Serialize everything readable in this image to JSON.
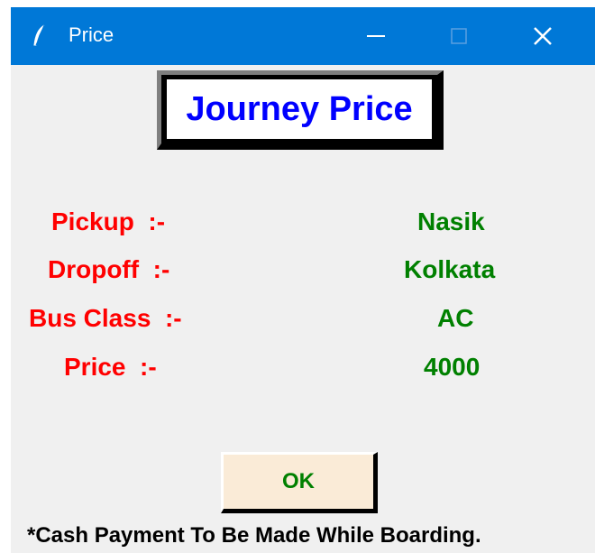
{
  "window": {
    "title": "Price",
    "icon": "feather-icon",
    "controls": [
      "minimize-icon",
      "maximize-icon",
      "close-icon"
    ],
    "titlebar_color": "#0078d7"
  },
  "heading": "Journey Price",
  "fields": [
    {
      "label": "Pickup  :-",
      "value": "Nasik"
    },
    {
      "label": "Dropoff  :-",
      "value": "Kolkata"
    },
    {
      "label": "Bus Class  :-",
      "value": "AC"
    },
    {
      "label": "Price  :-",
      "value": "4000"
    }
  ],
  "ok_label": "OK",
  "footer": "*Cash Payment To Be Made While Boarding.",
  "colors": {
    "label": "#ff0000",
    "value": "#008000",
    "heading": "#0000ff",
    "button_bg": "#faebd7"
  }
}
